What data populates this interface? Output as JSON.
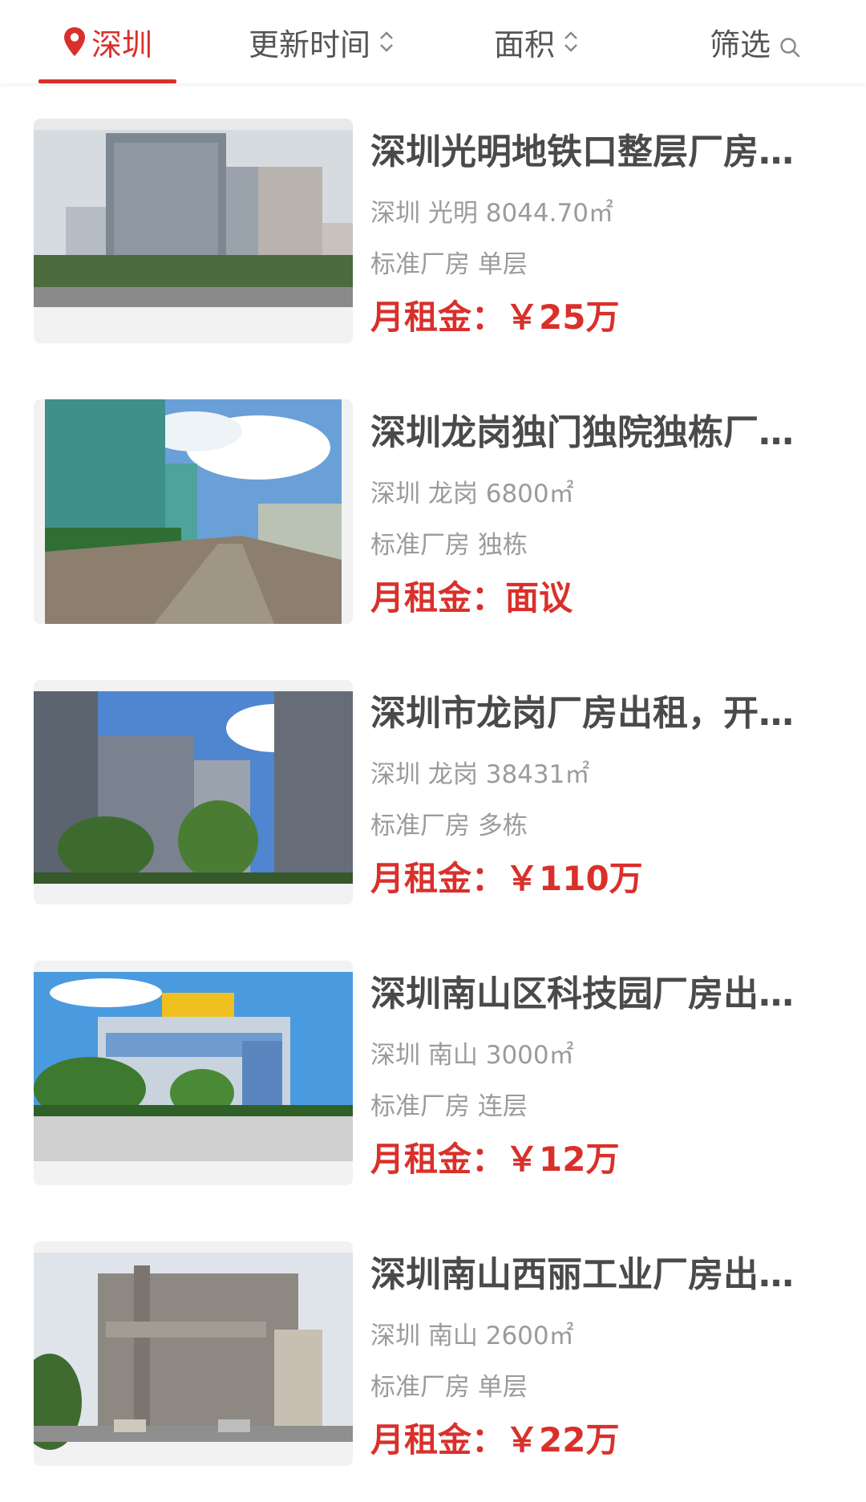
{
  "topbar": {
    "city": "深圳",
    "sort_update": "更新时间",
    "sort_area": "面积",
    "filter": "筛选"
  },
  "listings": [
    {
      "title": "深圳光明地铁口整层厂房…",
      "location": "深圳 光明",
      "area": "8044.70㎡",
      "type": "标准厂房",
      "floor": "单层",
      "price_label": "月租金：",
      "price": "￥25万"
    },
    {
      "title": "深圳龙岗独门独院独栋厂…",
      "location": "深圳 龙岗",
      "area": "6800㎡",
      "type": "标准厂房",
      "floor": "独栋",
      "price_label": "月租金：",
      "price": "面议"
    },
    {
      "title": "深圳市龙岗厂房出租，开…",
      "location": "深圳 龙岗",
      "area": "38431㎡",
      "type": "标准厂房",
      "floor": "多栋",
      "price_label": "月租金：",
      "price": "￥110万"
    },
    {
      "title": "深圳南山区科技园厂房出…",
      "location": "深圳 南山",
      "area": "3000㎡",
      "type": "标准厂房",
      "floor": "连层",
      "price_label": "月租金：",
      "price": "￥12万"
    },
    {
      "title": "深圳南山西丽工业厂房出…",
      "location": "深圳 南山",
      "area": "2600㎡",
      "type": "标准厂房",
      "floor": "单层",
      "price_label": "月租金：",
      "price": "￥22万"
    }
  ],
  "colors": {
    "accent": "#d9302b",
    "title": "#4a4a4a",
    "meta": "#9b9b9b"
  },
  "icons": {
    "city": "location-pin-icon",
    "sort": "sort-updown-icon",
    "filter": "search-icon"
  }
}
